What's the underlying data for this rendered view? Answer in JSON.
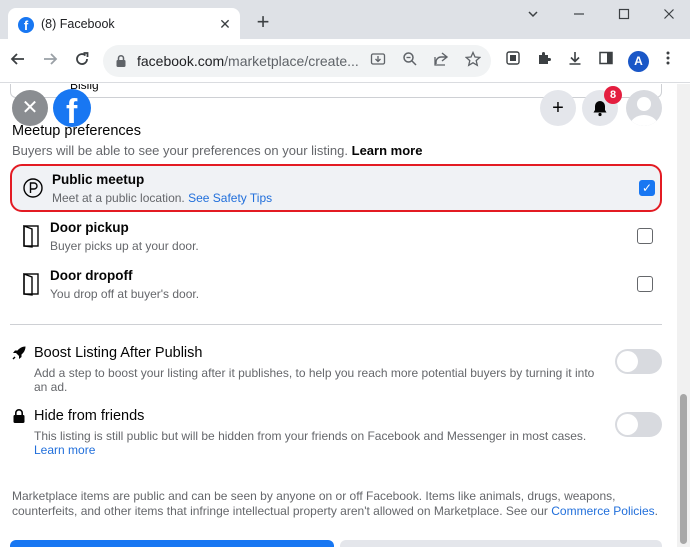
{
  "browser": {
    "tab_title": "(8) Facebook",
    "favicon_letter": "f",
    "tab_close": "✕",
    "new_tab": "+",
    "url_host": "facebook.com",
    "url_path": "/marketplace/create...",
    "profile_initial": "A"
  },
  "header": {
    "partial_field_text": "Bislig",
    "close_glyph": "✕",
    "logo_letter": "f",
    "create_glyph": "+",
    "notification_count": "8"
  },
  "meetup": {
    "title": "Meetup preferences",
    "subtitle": "Buyers will be able to see your preferences on your listing.",
    "learn_more": "Learn more",
    "options": [
      {
        "title": "Public meetup",
        "desc": "Meet at a public location.",
        "link": "See Safety Tips",
        "checked": true
      },
      {
        "title": "Door pickup",
        "desc": "Buyer picks up at your door.",
        "checked": false
      },
      {
        "title": "Door dropoff",
        "desc": "You drop off at buyer's door.",
        "checked": false
      }
    ]
  },
  "settings": {
    "boost": {
      "title": "Boost Listing After Publish",
      "desc": "Add a step to boost your listing after it publishes, to help you reach more potential buyers by turning it into an ad.",
      "enabled": false
    },
    "hide": {
      "title": "Hide from friends",
      "desc": "This listing is still public but will be hidden from your friends on Facebook and Messenger in most cases.",
      "link": "Learn more",
      "enabled": false
    }
  },
  "footer": {
    "text": "Marketplace items are public and can be seen by anyone on or off Facebook. Items like animals, drugs, weapons, counterfeits, and other items that infringe intellectual property aren't allowed on Marketplace. See our",
    "link": "Commerce Policies",
    "end": "."
  },
  "colors": {
    "brand": "#1877f2",
    "highlight": "#e31b23",
    "badge": "#e41e3f"
  }
}
